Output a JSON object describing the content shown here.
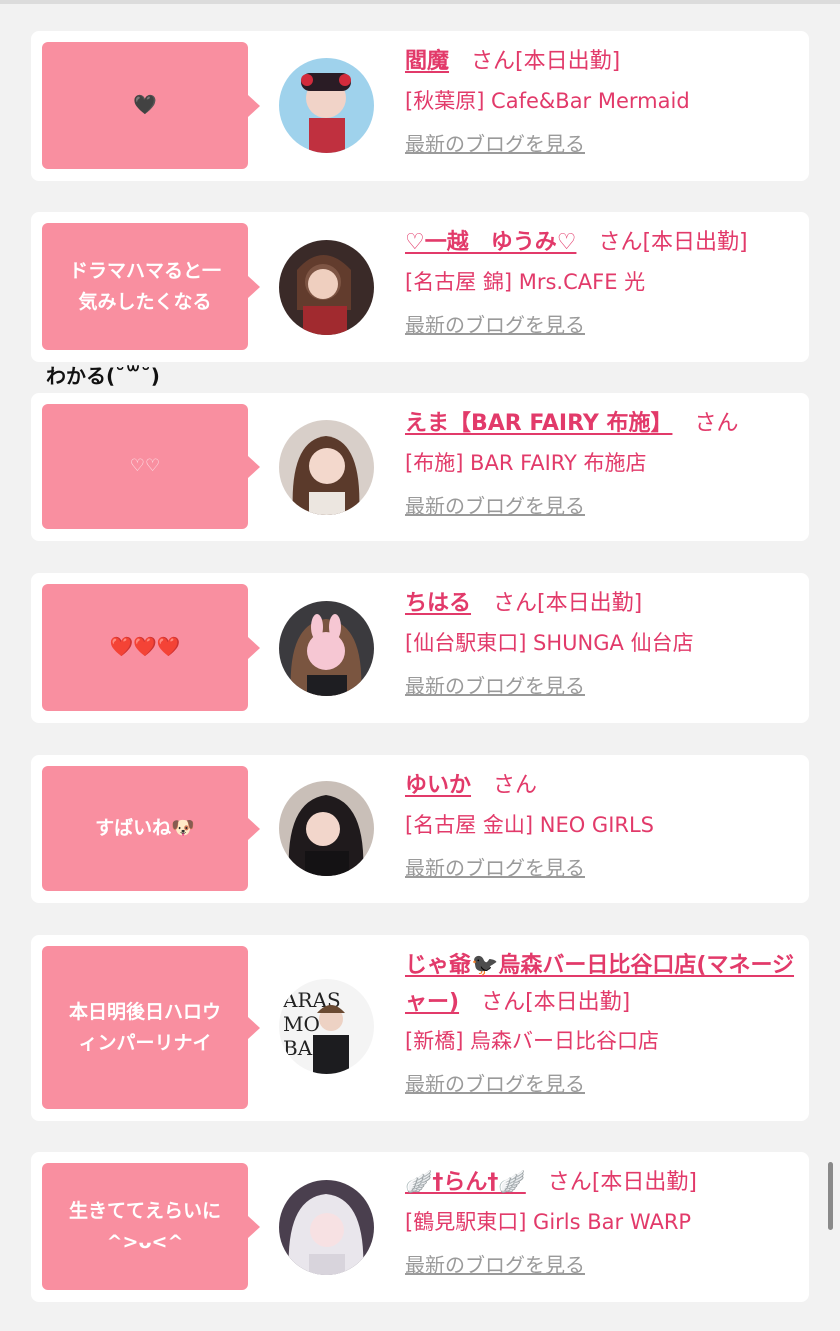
{
  "note_text": "わかる(˘꒳˘)",
  "blog_label": "最新のブログを見る",
  "cards": [
    {
      "bubble": "🖤",
      "name": "閻魔",
      "san": "さん",
      "status": "[本日出勤]",
      "shop": "[秋葉原] Cafe&Bar Mermaid",
      "avatar": "avatar-1"
    },
    {
      "bubble": "ドラマハマると一\n気みしたくなる",
      "name": "♡一越　ゆうみ♡",
      "san": "さん",
      "status": "[本日出勤]",
      "shop": "[名古屋 錦] Mrs.CAFE 光",
      "avatar": "avatar-2"
    },
    {
      "bubble": "♡♡",
      "name": "えま【BAR FAIRY 布施】",
      "san": "さん",
      "status": "",
      "shop": "[布施] BAR FAIRY 布施店",
      "avatar": "avatar-3"
    },
    {
      "bubble": "❤️❤️❤️",
      "name": "ちはる",
      "san": "さん",
      "status": "[本日出勤]",
      "shop": "[仙台駅東口] SHUNGA 仙台店",
      "avatar": "avatar-4"
    },
    {
      "bubble": "すばいね🐶",
      "name": "ゆいか",
      "san": "さん",
      "status": "",
      "shop": "[名古屋 金山] NEO GIRLS",
      "avatar": "avatar-5"
    },
    {
      "bubble": "本日明後日ハロウ\nィンパーリナイ",
      "name": "じゃ爺🐦‍⬛烏森バー日比谷口店(マネージャー)",
      "san": "さん",
      "status": "[本日出勤]",
      "shop": "[新橋] 烏森バー日比谷口店",
      "avatar": "avatar-6"
    },
    {
      "bubble": "生きててえらいに\n^>ᴗ<^",
      "name": "🪽†らん†🪽",
      "san": "さん",
      "status": "[本日出勤]",
      "shop": "[鶴見駅東口] Girls Bar WARP",
      "avatar": "avatar-7"
    }
  ]
}
